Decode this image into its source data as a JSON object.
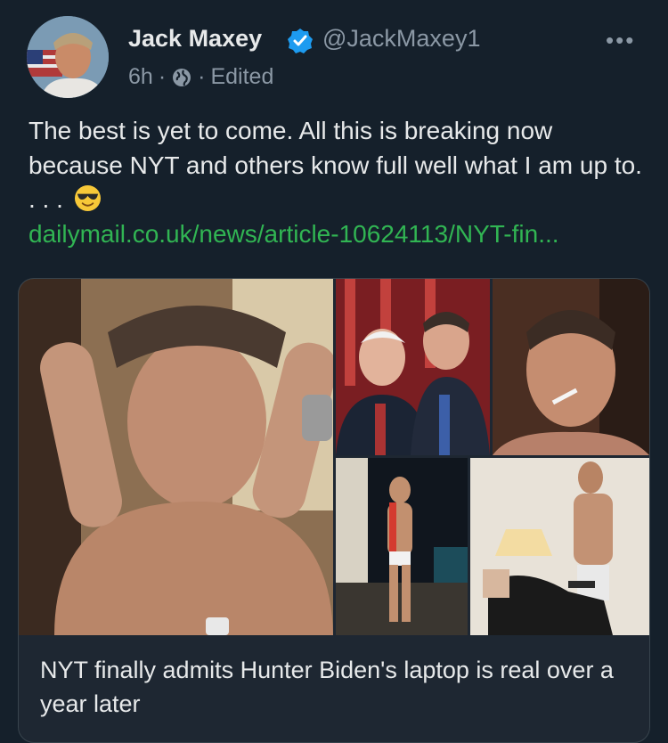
{
  "tweet": {
    "author_name": "Jack Maxey",
    "handle": "@JackMaxey1",
    "time": "6h",
    "edited": "Edited",
    "separator": "·",
    "more_label": "•••",
    "text": "The best is yet to come. All this is breaking now because NYT and others know full well what I am up to. . . .",
    "link_text": "dailymail.co.uk/news/article-10624113/NYT-fin..."
  },
  "card": {
    "title": "NYT finally admits Hunter Biden's laptop is real over a year later"
  },
  "icons": {
    "verified": "verified-badge-icon",
    "globe": "globe-icon",
    "emoji": "sunglasses-emoji-icon",
    "more": "more-options-icon"
  },
  "colors": {
    "background": "#15202b",
    "link": "#31b553",
    "verified": "#1d9bf0",
    "secondary_text": "#8b98a5"
  }
}
